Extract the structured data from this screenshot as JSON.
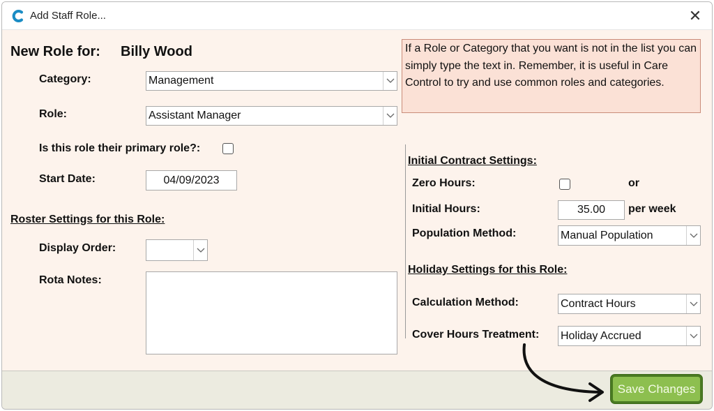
{
  "window": {
    "title": "Add Staff Role...",
    "close_glyph": "✕"
  },
  "header": {
    "prefix": "New Role for:",
    "staff_name": "Billy Wood"
  },
  "form": {
    "category_label": "Category:",
    "category_value": "Management",
    "role_label": "Role:",
    "role_value": "Assistant Manager",
    "primary_role_label": "Is this role their primary role?:",
    "primary_role_checked": false,
    "start_date_label": "Start Date:",
    "start_date_value": "04/09/2023"
  },
  "info_box": {
    "text": "If a Role or Category that you want is not in the list you can simply type the text in.  Remember, it is useful in Care Control to try and use common roles and categories."
  },
  "roster": {
    "section_title": "Roster Settings for this Role:",
    "display_order_label": "Display Order:",
    "display_order_value": "",
    "rota_notes_label": "Rota Notes:",
    "rota_notes_value": ""
  },
  "contract": {
    "section_title": "Initial Contract Settings:",
    "zero_hours_label": "Zero Hours:",
    "zero_hours_checked": false,
    "or_label": "or",
    "initial_hours_label": "Initial Hours:",
    "initial_hours_value": "35.00",
    "per_week_label": "per week",
    "population_method_label": "Population Method:",
    "population_method_value": "Manual Population"
  },
  "holiday": {
    "section_title": "Holiday Settings for this Role:",
    "calculation_method_label": "Calculation Method:",
    "calculation_method_value": "Contract Hours",
    "cover_hours_label": "Cover Hours Treatment:",
    "cover_hours_value": "Holiday Accrued"
  },
  "footer": {
    "save_label": "Save Changes"
  },
  "colors": {
    "window_bg": "#fdf3ec",
    "footer_bg": "#ecebe0",
    "info_bg": "#fbe1d6",
    "info_border": "#c98c7a",
    "save_bg": "#8dbf4f",
    "save_border": "#4a7a22",
    "app_icon": "#1a8cc4"
  },
  "icons": [
    "app-logo-icon",
    "close-icon",
    "chevron-down-icon",
    "curved-arrow-icon"
  ]
}
